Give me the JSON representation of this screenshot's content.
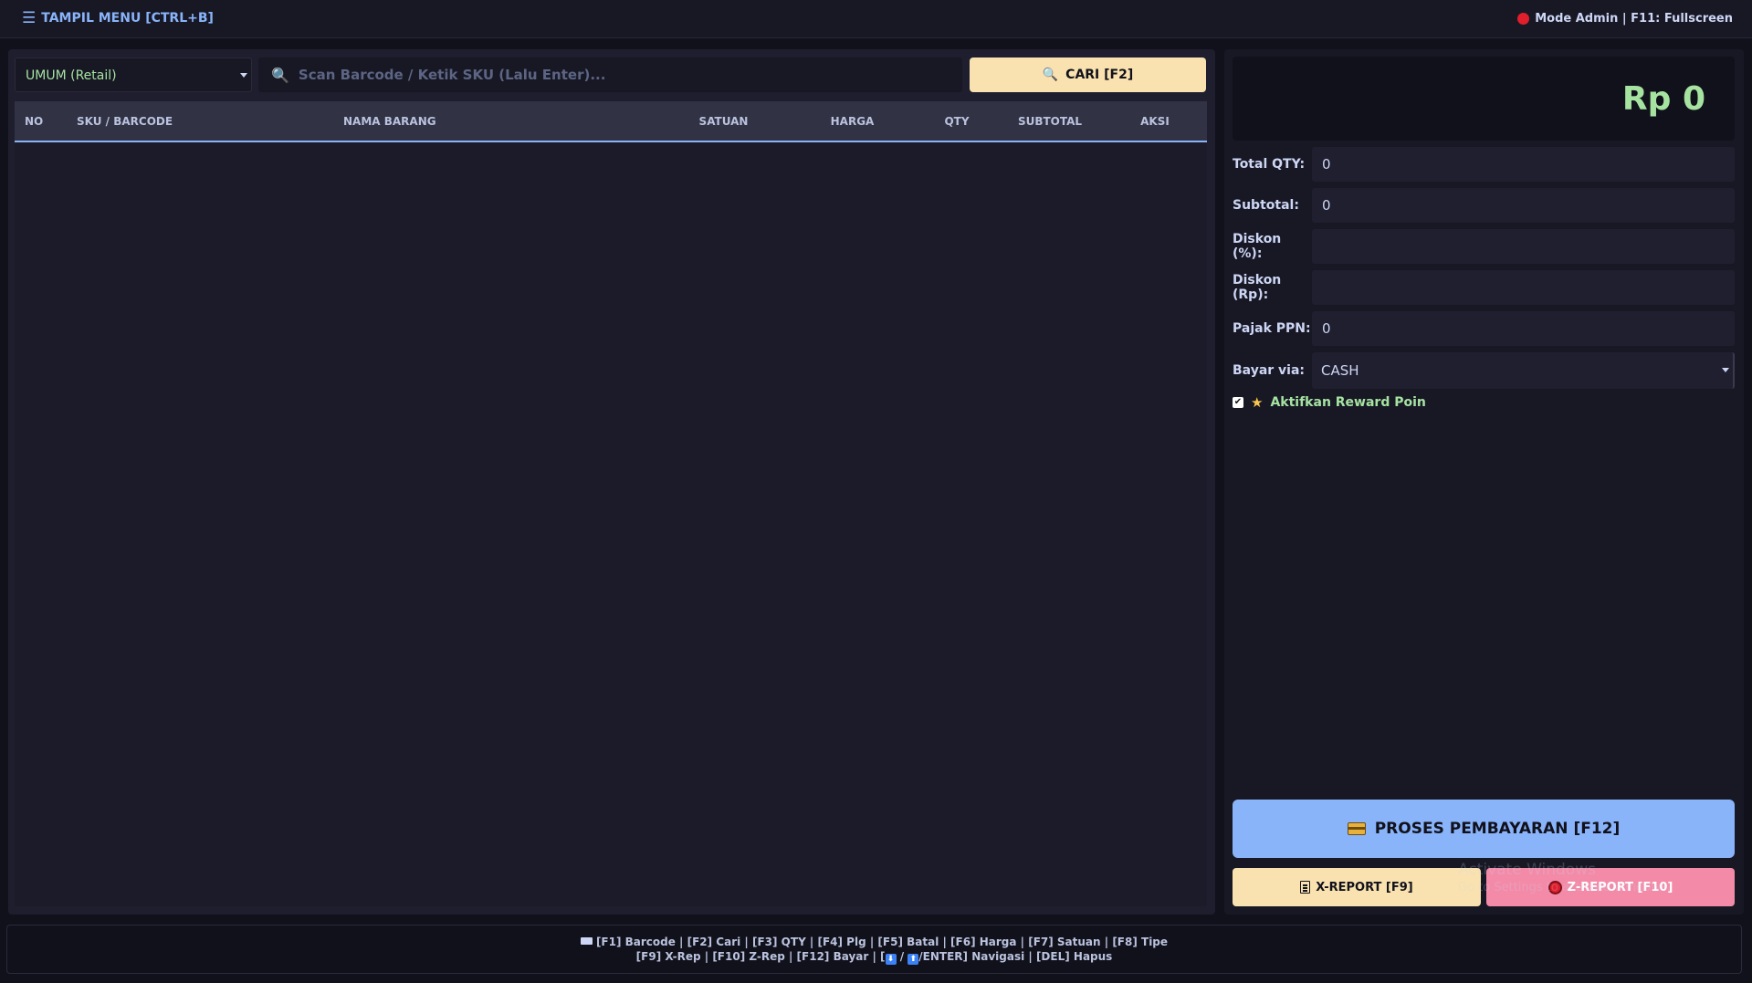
{
  "topbar": {
    "menu_label": "TAMPIL MENU [CTRL+B]",
    "status_text": "Mode Admin | F11: Fullscreen",
    "status_color": "#e01e2c"
  },
  "sale": {
    "customer_type": "UMUM (Retail)",
    "barcode_placeholder": "Scan Barcode / Ketik SKU (Lalu Enter)...",
    "search_label": "CARI [F2]",
    "columns": [
      "NO",
      "SKU / BARCODE",
      "NAMA BARANG",
      "SATUAN",
      "HARGA",
      "QTY",
      "SUBTOTAL",
      "AKSI"
    ],
    "rows": []
  },
  "summary": {
    "grand_total": "Rp 0",
    "total_qty_label": "Total QTY:",
    "total_qty": "0",
    "subtotal_label": "Subtotal:",
    "subtotal": "0",
    "diskon_pct_label": "Diskon (%):",
    "diskon_pct": "",
    "diskon_rp_label": "Diskon (Rp):",
    "diskon_rp": "",
    "pajak_label": "Pajak PPN:",
    "pajak": "0",
    "bayar_label": "Bayar via:",
    "bayar_value": "CASH",
    "reward_label": "Aktifkan Reward Poin",
    "reward_checked": true
  },
  "actions": {
    "pay_label": "PROSES PEMBAYARAN [F12]",
    "xreport_label": "X-REPORT [F9]",
    "zreport_label": "Z-REPORT [F10]"
  },
  "watermark": {
    "line1": "Activate Windows",
    "line2": "Go to Settings to activate Windows."
  },
  "footer": {
    "line1": "[F1] Barcode | [F2] Cari | [F3] QTY | [F4] Plg | [F5] Batal | [F6] Harga | [F7] Satuan | [F8] Tipe",
    "line2_prefix": "[F9] X-Rep | [F10] Z-Rep | [F12] Bayar | [",
    "line2_suffix": "/ENTER] Navigasi | [DEL] Hapus"
  },
  "colors": {
    "accent": "#89b4fa",
    "success": "#a6e3a1",
    "warning": "#f9e2af",
    "danger": "#f38ba8"
  },
  "icons": [
    "hamburger-icon",
    "search-icon",
    "credit-card-icon",
    "document-icon",
    "red-circle-icon",
    "star-icon",
    "keyboard-icon",
    "arrow-down-icon",
    "arrow-up-icon"
  ]
}
